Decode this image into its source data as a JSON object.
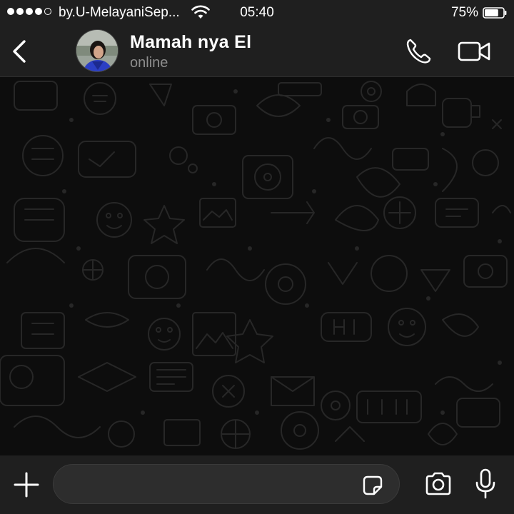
{
  "status_bar": {
    "carrier": "by.U-MelayaniSep...",
    "time": "05:40",
    "battery_percent": "75%",
    "battery_level": 0.75,
    "signal_bars": 4,
    "signal_max": 5
  },
  "header": {
    "back_icon": "chevron-left-icon",
    "contact_name": "Mamah nya El",
    "contact_status": "online",
    "call_icon": "phone-icon",
    "video_icon": "video-camera-icon"
  },
  "composer": {
    "message_value": "",
    "plus_icon": "plus-icon",
    "sticker_icon": "sticker-icon",
    "camera_icon": "camera-icon",
    "mic_icon": "microphone-icon"
  },
  "colors": {
    "bar_background": "#1f1f1f",
    "chat_background": "#0d0d0d",
    "wallpaper_line": "#262626",
    "secondary_text": "#8e8e8e",
    "field_background": "#2d2d2d"
  }
}
